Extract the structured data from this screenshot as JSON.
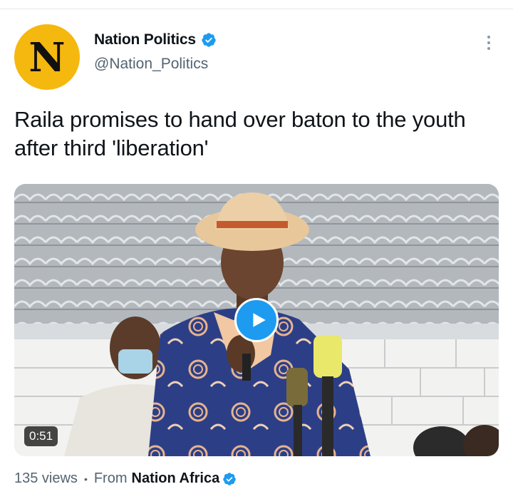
{
  "tweet": {
    "avatar_letter": "N",
    "display_name": "Nation Politics",
    "handle": "@Nation_Politics",
    "verified": true,
    "more_icon": "more-vertical-icon",
    "text": "Raila promises to hand over baton to the youth after third 'liberation'"
  },
  "media": {
    "type": "video",
    "play_icon": "play-icon",
    "duration": "0:51"
  },
  "footer": {
    "views": "135 views",
    "separator": "•",
    "from_label": "From",
    "source_name": "Nation Africa",
    "source_verified": true
  },
  "colors": {
    "avatar_bg": "#f5b80f",
    "verified_blue": "#1d9bf0",
    "text_primary": "#0f1419",
    "text_secondary": "#536471"
  }
}
